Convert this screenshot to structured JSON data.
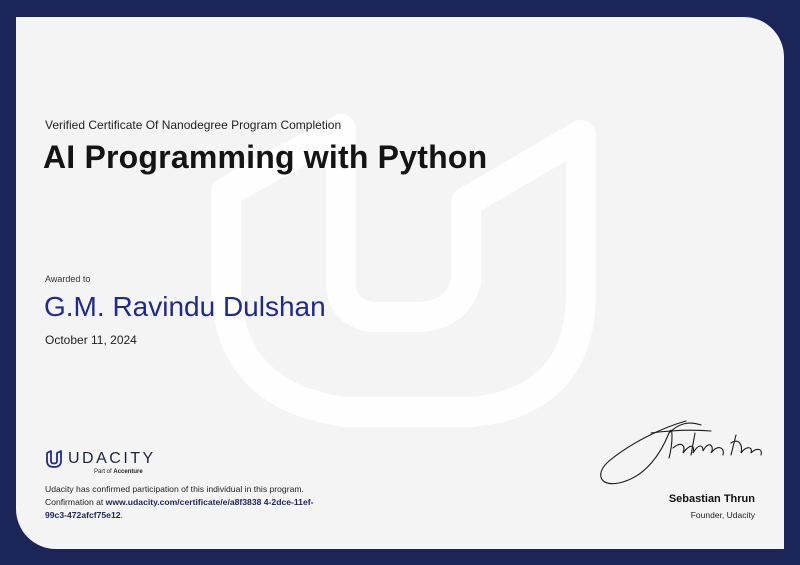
{
  "certificate": {
    "subtitle": "Verified Certificate Of Nanodegree Program Completion",
    "title": "AI Programming with Python",
    "awarded_label": "Awarded to",
    "recipient": "G.M. Ravindu Dulshan",
    "date": "October 11, 2024"
  },
  "brand": {
    "name": "UDACITY",
    "sub_prefix": "Part of",
    "sub_company": "Accenture",
    "logo_icon": "udacity-u-icon",
    "color": "#1f2a8c"
  },
  "confirmation": {
    "text_before": "Udacity has confirmed participation of this individual in this program. Confirmation at",
    "url": "www.udacity.com/certificate/e/a8f3838 4-2dce-11ef-99c3-472afcf75e12",
    "text_after": "."
  },
  "signatory": {
    "name": "Sebastian Thrun",
    "title": "Founder, Udacity"
  },
  "colors": {
    "frame": "#1c2558",
    "background": "#f4f4f5",
    "accent": "#1f2a8c"
  }
}
